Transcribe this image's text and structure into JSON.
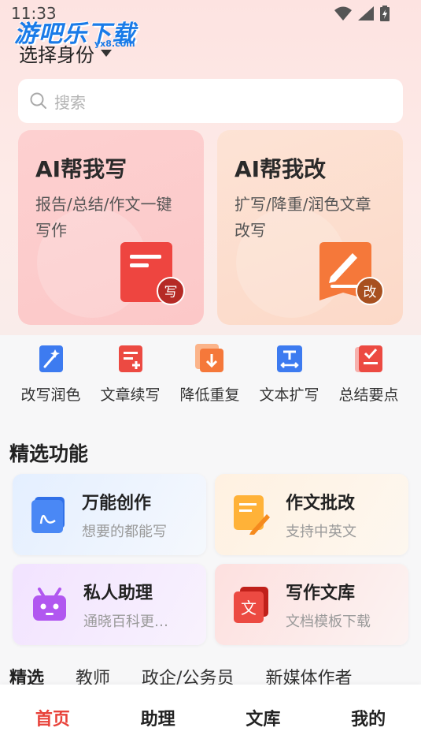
{
  "status_bar": {
    "time": "11:33"
  },
  "watermark": {
    "text": "游吧乐下载",
    "sub": "yx8.com"
  },
  "header": {
    "identity_label": "选择身份"
  },
  "search": {
    "placeholder": "搜索"
  },
  "hero_cards": [
    {
      "title": "AI帮我写",
      "desc": "报告/总结/作文一键写作",
      "badge": "写",
      "color": "#ee4540"
    },
    {
      "title": "AI帮我改",
      "desc": "扩写/降重/润色文章改写",
      "badge": "改",
      "color": "#f5783a"
    }
  ],
  "quick_tools": [
    {
      "label": "改写润色",
      "icon": "magic-wand-icon"
    },
    {
      "label": "文章续写",
      "icon": "document-plus-icon"
    },
    {
      "label": "降低重复",
      "icon": "download-doc-icon"
    },
    {
      "label": "文本扩写",
      "icon": "text-expand-icon"
    },
    {
      "label": "总结要点",
      "icon": "checklist-icon"
    }
  ],
  "featured": {
    "title": "精选功能",
    "items": [
      {
        "title": "万能创作",
        "subtitle": "想要的都能写",
        "icon": "notebook-icon"
      },
      {
        "title": "作文批改",
        "subtitle": "支持中英文",
        "icon": "note-pencil-icon"
      },
      {
        "title": "私人助理",
        "subtitle": "通晓百科更…",
        "icon": "robot-icon"
      },
      {
        "title": "写作文库",
        "subtitle": "文档模板下载",
        "icon": "library-icon"
      }
    ]
  },
  "categories": [
    "精选",
    "教师",
    "政企/公务员",
    "新媒体作者"
  ],
  "bottom_nav": [
    {
      "label": "首页",
      "active": true
    },
    {
      "label": "助理",
      "active": false
    },
    {
      "label": "文库",
      "active": false
    },
    {
      "label": "我的",
      "active": false
    }
  ],
  "colors": {
    "accent": "#e8423a",
    "brand_blue": "#1a7be8"
  }
}
